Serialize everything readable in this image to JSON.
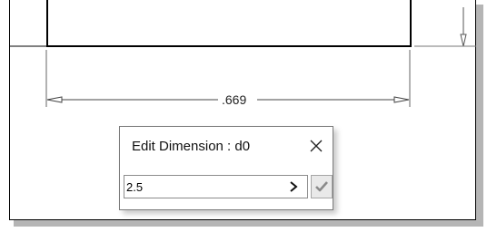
{
  "drawing": {
    "dimension_value": ".669"
  },
  "dialog": {
    "title": "Edit Dimension : d0",
    "input_value": "2.5"
  },
  "icons": {
    "close": "close-icon",
    "expand": "chevron-right-icon",
    "confirm": "checkmark-icon"
  },
  "colors": {
    "line": "#000000",
    "dimension_line": "#444444",
    "confirm_check": "#8a8a8a"
  }
}
